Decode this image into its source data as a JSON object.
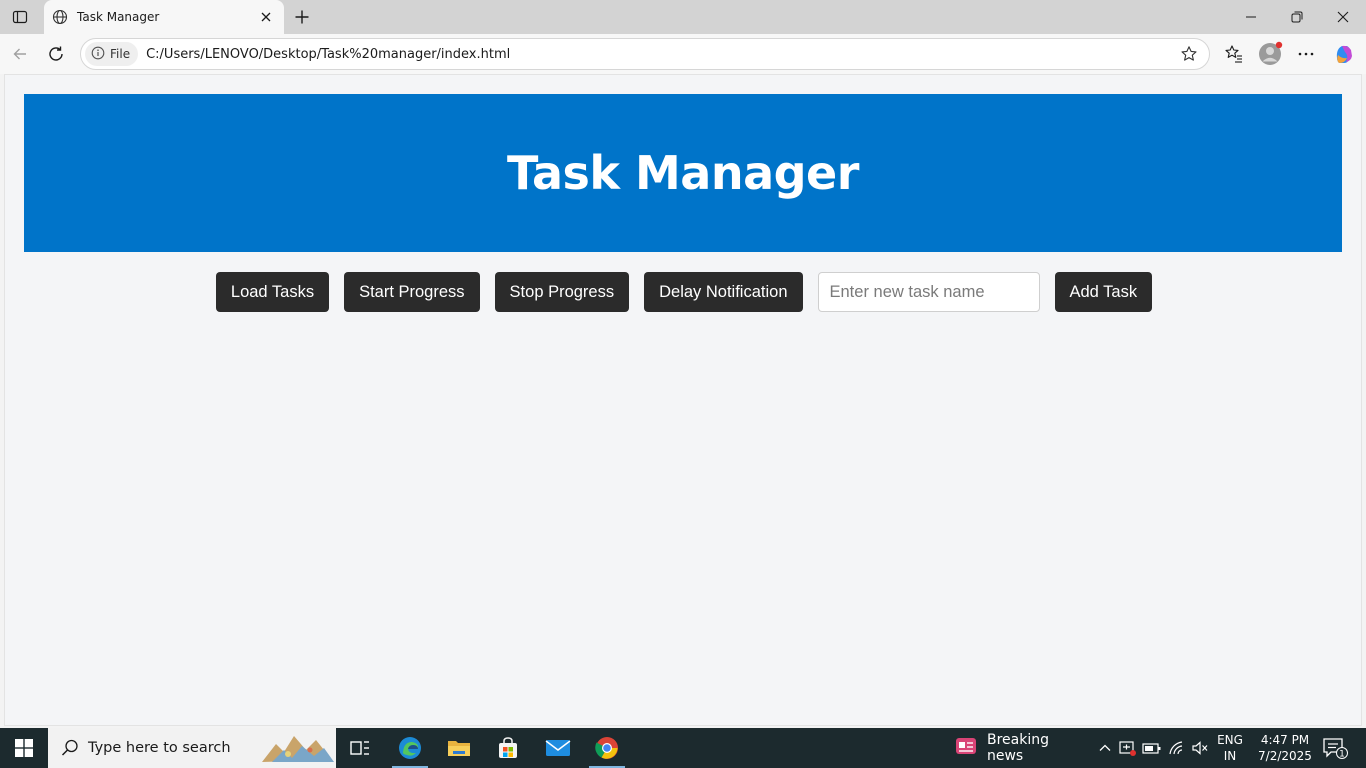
{
  "browser": {
    "tab_title": "Task Manager",
    "site_chip_label": "File",
    "url": "C:/Users/LENOVO/Desktop/Task%20manager/index.html"
  },
  "page": {
    "title": "Task Manager",
    "buttons": {
      "load_tasks": "Load Tasks",
      "start_progress": "Start Progress",
      "stop_progress": "Stop Progress",
      "delay_notification": "Delay Notification",
      "add_task": "Add Task"
    },
    "task_input_placeholder": "Enter new task name"
  },
  "taskbar": {
    "search_placeholder": "Type here to search",
    "news_label": "Breaking news",
    "lang_line1": "ENG",
    "lang_line2": "IN",
    "time": "4:47 PM",
    "date": "7/2/2025",
    "notification_count": "1"
  },
  "colors": {
    "header_bg": "#0074c9",
    "button_bg": "#2b2b2b",
    "page_bg": "#f4f5f7",
    "taskbar_bg": "#1c2a2e"
  },
  "icons": [
    "tab-actions-icon",
    "globe-icon",
    "close-tab-icon",
    "new-tab-icon",
    "minimize-icon",
    "restore-icon",
    "close-window-icon",
    "back-icon",
    "refresh-icon",
    "info-icon",
    "favorite-star-icon",
    "favorites-icon",
    "profile-icon",
    "more-icon",
    "copilot-icon",
    "windows-start-icon",
    "search-icon",
    "task-view-icon",
    "edge-icon",
    "file-explorer-icon",
    "store-icon",
    "mail-icon",
    "chrome-icon",
    "news-icon",
    "chevron-up-icon",
    "meet-icon",
    "battery-icon",
    "wifi-icon",
    "volume-muted-icon",
    "notifications-icon"
  ]
}
